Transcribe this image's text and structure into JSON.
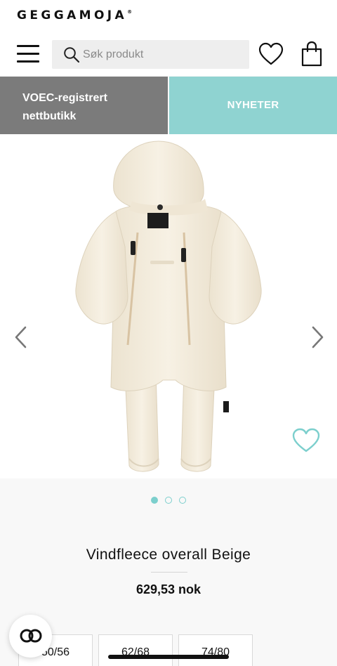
{
  "header": {
    "logo_text": "GEGGAMOJA",
    "logo_mark": "®",
    "search_placeholder": "Søk produkt"
  },
  "promo": {
    "left_label": "VOEC-registrert nettbutikk",
    "right_label": "NYHETER",
    "left_color": "#7b7b7b",
    "right_color": "#8fd3d1"
  },
  "gallery": {
    "image_count": 3,
    "active_index": 0
  },
  "product": {
    "title": "Vindfleece overall Beige",
    "price": "629,53 nok"
  },
  "sizes": [
    "50/56",
    "62/68",
    "74/80"
  ],
  "icons": {
    "menu": "hamburger-icon",
    "search": "search-icon",
    "wishlist": "heart-icon",
    "bag": "shopping-bag-icon",
    "prev": "chevron-left-icon",
    "next": "chevron-right-icon",
    "favorite": "heart-outline-icon",
    "chat": "chat-icon"
  },
  "accent_color": "#7ccfcd"
}
